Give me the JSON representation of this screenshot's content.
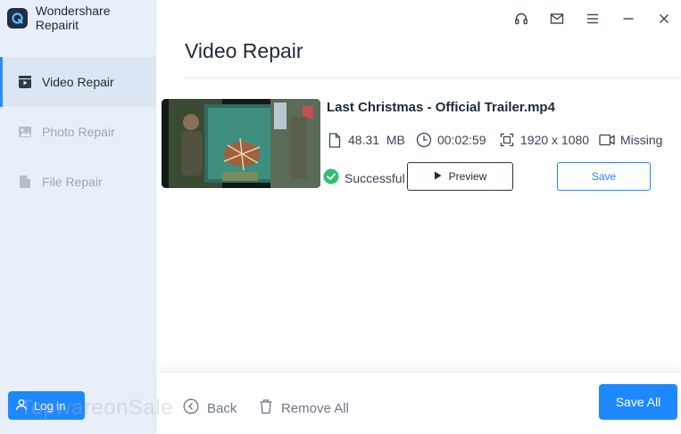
{
  "app": {
    "name": "Wondershare Repairit"
  },
  "sidebar": {
    "items": [
      {
        "label": "Video Repair",
        "icon": "video-file-icon",
        "active": true
      },
      {
        "label": "Photo Repair",
        "icon": "image-icon",
        "active": false
      },
      {
        "label": "File Repair",
        "icon": "document-icon",
        "active": false
      }
    ],
    "login_label": "Log in"
  },
  "titlebar": {
    "icons": [
      "headset-icon",
      "mail-icon",
      "menu-icon",
      "minimize-icon",
      "close-icon"
    ]
  },
  "main": {
    "title": "Video Repair",
    "file": {
      "name": "Last Christmas - Official Trailer.mp4",
      "size": "48.31  MB",
      "duration": "00:02:59",
      "resolution": "1920 x 1080",
      "camera": "Missing",
      "status": "Successful",
      "preview_label": "Preview",
      "save_label": "Save"
    }
  },
  "footer": {
    "back_label": "Back",
    "remove_all_label": "Remove All",
    "save_all_label": "Save All"
  },
  "watermark": "TopwareonSale",
  "colors": {
    "accent": "#1e88ff",
    "success": "#2fbf71",
    "sidebar_bg": "#e9eff8"
  }
}
